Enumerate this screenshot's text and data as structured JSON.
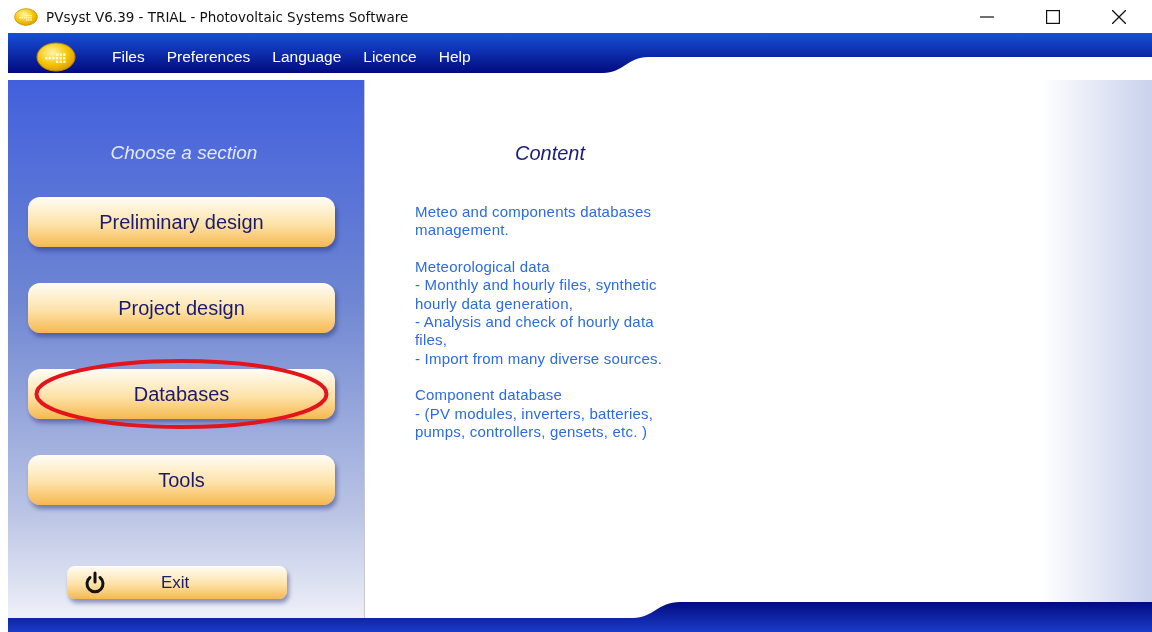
{
  "window": {
    "title": "PVsyst V6.39 - TRIAL - Photovoltaic Systems Software"
  },
  "menu": [
    "Files",
    "Preferences",
    "Language",
    "Licence",
    "Help"
  ],
  "sidebar": {
    "heading": "Choose a section",
    "items": [
      {
        "label": "Preliminary design",
        "highlighted": false
      },
      {
        "label": "Project design",
        "highlighted": false
      },
      {
        "label": "Databases",
        "highlighted": true
      },
      {
        "label": "Tools",
        "highlighted": false
      }
    ],
    "exit": "Exit"
  },
  "content": {
    "title": "Content",
    "paragraphs": [
      [
        "Meteo and components databases",
        "management."
      ],
      [
        "Meteorological data",
        "- Monthly and hourly files, synthetic",
        "hourly data generation,",
        "- Analysis and check of hourly data",
        "files,",
        "- Import from many diverse sources."
      ],
      [
        "Component database",
        "- (PV modules, inverters, batteries,",
        "pumps, controllers, gensets, etc. )"
      ]
    ]
  }
}
